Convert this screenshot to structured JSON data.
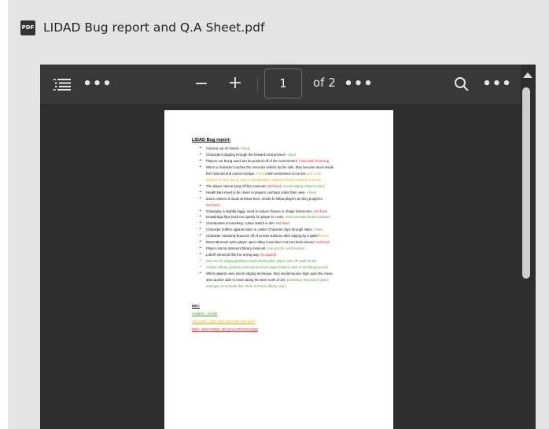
{
  "file": {
    "icon_label": "PDF",
    "name": "LIDAD Bug report and Q.A Sheet.pdf"
  },
  "toolbar": {
    "zoom_out": "−",
    "zoom_in": "+",
    "page_current": "1",
    "page_total": "of 2",
    "more": "•••"
  },
  "document": {
    "title": "LIDAD Bug report:",
    "items": [
      {
        "type": "normal",
        "parts": [
          {
            "t": "Camera out of control – "
          },
          {
            "t": "fixed",
            "c": "green"
          }
        ]
      },
      {
        "type": "normal",
        "parts": [
          {
            "t": "Characters clipping through the forward environment – "
          },
          {
            "t": "fixed",
            "c": "green"
          }
        ]
      },
      {
        "type": "normal",
        "parts": [
          {
            "t": "Players not being used can be pushed off of the environment. "
          },
          {
            "t": "Fixed with bouncing.",
            "c": "red"
          }
        ]
      },
      {
        "type": "normal",
        "parts": [
          {
            "t": "When a character touches the minecart vehicle by the side, they become stuck inside"
          }
        ]
      },
      {
        "type": "cont",
        "parts": [
          {
            "t": "the minecart and cannot escape. "
          },
          {
            "t": "Fixed",
            "c": "yellow"
          },
          {
            "t": " crash sometimes occur but "
          },
          {
            "t": "new route",
            "c": "yellow"
          }
        ]
      },
      {
        "type": "cont",
        "parts": [
          {
            "t": "applied for time being. Way to fixed/players degrees show if solution is found.",
            "c": "yellow"
          }
        ]
      },
      {
        "type": "normal",
        "parts": [
          {
            "t": "The player cannot jump off the minecart. "
          },
          {
            "t": "Not fixed,",
            "c": "red"
          },
          {
            "t": " "
          },
          {
            "t": "secret edging solution used.",
            "c": "green"
          }
        ]
      },
      {
        "type": "normal",
        "parts": [
          {
            "t": "Health bars need to be closer to players, perhaps under their view. – "
          },
          {
            "t": "fixed",
            "c": "green"
          }
        ]
      },
      {
        "type": "normal",
        "parts": [
          {
            "t": "Zoom camera is stuck at Mesa level, needs to follow players as they progress."
          }
        ]
      },
      {
        "type": "cont",
        "parts": [
          {
            "t": "Not fixed",
            "c": "red"
          }
        ]
      },
      {
        "type": "normal",
        "parts": [
          {
            "t": "Gameplay is slightly laggy, need to reduce frames or shape tris/vectors. "
          },
          {
            "t": "Not fixed",
            "c": "red"
          }
        ]
      },
      {
        "type": "normal",
        "parts": [
          {
            "t": "Drawbridge flips back too quickly for player to cross. "
          },
          {
            "t": "Used activated button instead.",
            "c": "green"
          }
        ]
      },
      {
        "type": "normal",
        "parts": [
          {
            "t": "Checkpoints not working, colour switch is dim. "
          },
          {
            "t": "Not fixed.",
            "c": "red"
          }
        ]
      },
      {
        "type": "normal",
        "parts": [
          {
            "t": "Character buffers against stairs in castle/ Character clips through stairs. "
          },
          {
            "t": "Fixed.",
            "c": "green"
          }
        ]
      },
      {
        "type": "normal",
        "parts": [
          {
            "t": "Character randomly bounces off of certain surfaces after edging by a spike? "
          },
          {
            "t": "Fixed",
            "c": "yellow"
          }
        ]
      },
      {
        "type": "normal",
        "parts": [
          {
            "t": "Mesa Minecart spins player upon riding it and does not turn back around. "
          },
          {
            "t": "not fixed.",
            "c": "red"
          }
        ]
      },
      {
        "type": "normal",
        "parts": [
          {
            "t": "Player cannot dismount library minecart, "
          },
          {
            "t": "new puzzle used instead.",
            "c": "green"
          }
        ]
      },
      {
        "type": "normal",
        "parts": [
          {
            "t": "Lab lift minecart tilts the wrong way. "
          },
          {
            "t": "(scrapped)",
            "c": "red"
          }
        ]
      },
      {
        "type": "green",
        "parts": [
          {
            "t": "New secret edging pathway implemented after player sets off castle bomb."
          }
        ]
      },
      {
        "type": "green",
        "parts": [
          {
            "t": "Sunken library gondola minecart bounces player back to start of 3rd library puzzle."
          }
        ]
      },
      {
        "type": "normal",
        "parts": [
          {
            "t": "When players uses secret edging technique, they would bounce high upon the mesa"
          }
        ]
      },
      {
        "type": "cont",
        "parts": [
          {
            "t": "area and be able to move along the level roofs of 3/4. "
          },
          {
            "t": "(somehow fixed but if player",
            "c": "green"
          }
        ]
      },
      {
        "type": "cont",
        "parts": [
          {
            "t": "manages to recreate this, there is hole in library roof.)",
            "c": "green"
          }
        ]
      }
    ],
    "key": {
      "title": "KEY:",
      "green": "GREEN = DONE",
      "yellow": "YELLOW = NOT SOLVED FOR THE WAY",
      "red": "RED= NOT FIXED, NO SOLUTION FOUND"
    }
  },
  "colors": {
    "green": "#4aa33a",
    "yellow": "#e0a800",
    "red": "#e02020",
    "toolbar_bg": "#383838",
    "viewer_bg": "#2e2e2e"
  },
  "icons": [
    "pdf-file-icon",
    "outline-list-icon",
    "more-options-icon",
    "zoom-out-icon",
    "zoom-in-icon",
    "search-icon",
    "scroll-up-icon"
  ]
}
